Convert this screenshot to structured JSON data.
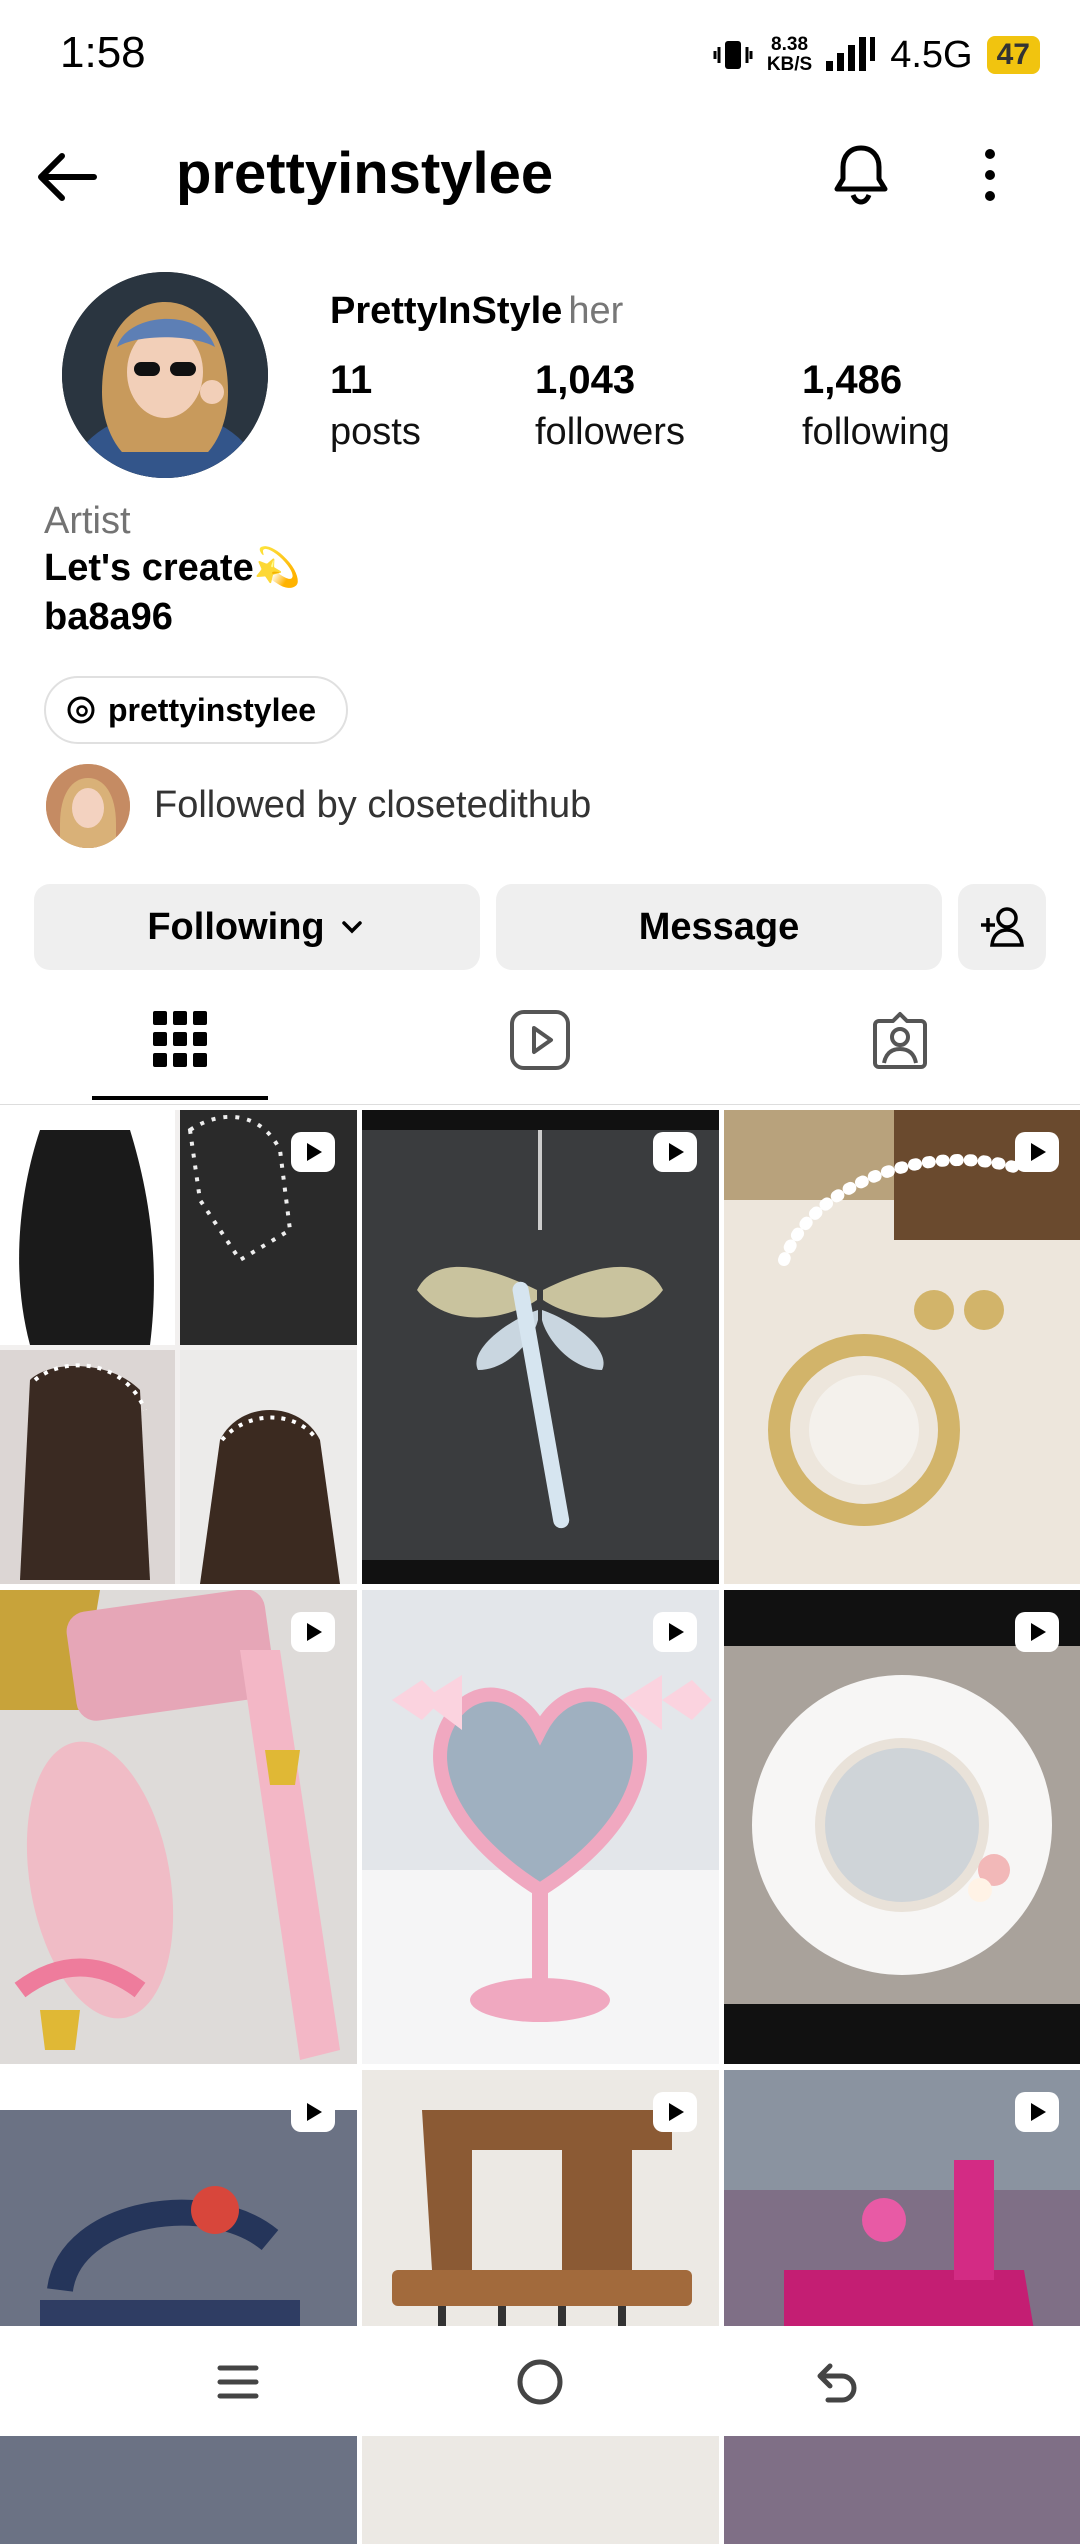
{
  "status": {
    "time": "1:58",
    "speed_top": "8.38",
    "speed_bottom": "KB/S",
    "network": "4.5G",
    "battery": "47"
  },
  "header": {
    "username": "prettyinstylee",
    "back_icon": "arrow-left-icon",
    "bell_icon": "bell-icon",
    "menu_icon": "more-vertical-icon"
  },
  "profile": {
    "display_name": "PrettyInStyle",
    "pronouns": "her",
    "stats": [
      {
        "value": "11",
        "label": "posts"
      },
      {
        "value": "1,043",
        "label": "followers"
      },
      {
        "value": "1,486",
        "label": "following"
      }
    ],
    "category": "Artist",
    "bio_line1": "Let's create💫",
    "bio_line2": "ba8a96",
    "threads_handle": "prettyinstylee",
    "followed_by": "Followed by closetedithub"
  },
  "actions": {
    "following": "Following",
    "message": "Message",
    "add_user_icon": "add-person-icon"
  },
  "tabs": [
    "grid-icon",
    "reels-icon",
    "tagged-icon"
  ],
  "grid": [
    {
      "desc": "pearl hair net",
      "bg": "#e8e4e4",
      "reel": true
    },
    {
      "desc": "crystal dragonfly",
      "bg": "#2d2f31",
      "reel": true
    },
    {
      "desc": "pearl necklace mirror",
      "bg": "#ede6dc",
      "reel": true
    },
    {
      "desc": "pink comb and brush",
      "bg": "#e6c5cd",
      "reel": true
    },
    {
      "desc": "pink heart mirror",
      "bg": "#e3e6ea",
      "reel": true
    },
    {
      "desc": "tulle mirror",
      "bg": "#1b1b1b",
      "reel": true
    },
    {
      "desc": "denim ruffle bag",
      "bg": "#5c6a80",
      "reel": true
    },
    {
      "desc": "wooden sewing machine hook",
      "bg": "#ece9e4",
      "reel": true
    },
    {
      "desc": "pink sewing machine",
      "bg": "#6b3a52",
      "reel": true
    }
  ],
  "navbar": {
    "menu_icon": "menu-icon",
    "home_icon": "home-circle-icon",
    "back_icon": "back-icon"
  }
}
